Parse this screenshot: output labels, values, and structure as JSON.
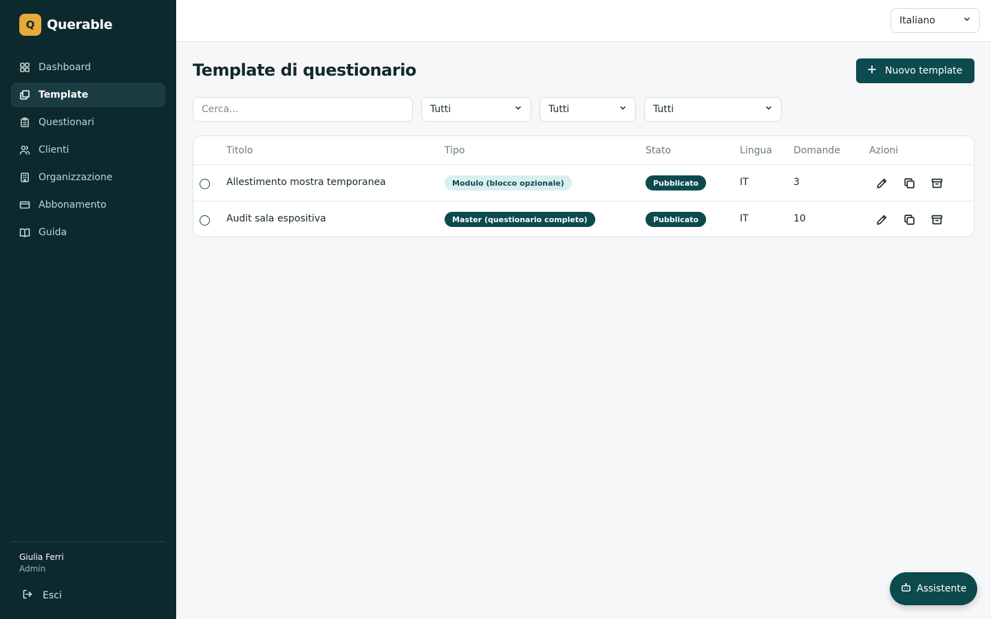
{
  "app": {
    "logo_letter": "Q",
    "name": "Querable"
  },
  "sidebar": {
    "items": [
      {
        "label": "Dashboard",
        "icon": "dashboard-icon",
        "active": false
      },
      {
        "label": "Template",
        "icon": "template-icon",
        "active": true
      },
      {
        "label": "Questionari",
        "icon": "clipboard-icon",
        "active": false
      },
      {
        "label": "Clienti",
        "icon": "users-icon",
        "active": false
      },
      {
        "label": "Organizzazione",
        "icon": "building-icon",
        "active": false
      },
      {
        "label": "Abbonamento",
        "icon": "credit-card-icon",
        "active": false
      },
      {
        "label": "Guida",
        "icon": "book-icon",
        "active": false
      }
    ],
    "user": {
      "name": "Giulia Ferri",
      "role": "Admin"
    },
    "logout_label": "Esci"
  },
  "topbar": {
    "language": "Italiano"
  },
  "page": {
    "title": "Template di questionario",
    "new_button_label": "Nuovo template",
    "search_placeholder": "Cerca...",
    "filters": [
      "Tutti",
      "Tutti",
      "Tutti"
    ]
  },
  "table": {
    "headers": [
      "Titolo",
      "Tipo",
      "Stato",
      "Lingua",
      "Domande",
      "Azioni"
    ],
    "rows": [
      {
        "title": "Allestimento mostra temporanea",
        "type": "Modulo (blocco opzionale)",
        "type_style": "light",
        "status": "Pubblicato",
        "language": "IT",
        "questions": "3"
      },
      {
        "title": "Audit sala espositiva",
        "type": "Master (questionario completo)",
        "type_style": "dark",
        "status": "Pubblicato",
        "language": "IT",
        "questions": "10"
      }
    ]
  },
  "assistant": {
    "label": "Assistente"
  },
  "colors": {
    "sidebar_bg": "#0c2a2e",
    "primary": "#0c4a4e",
    "accent_logo": "#e6a93a",
    "badge_light": "#d9eeee"
  }
}
